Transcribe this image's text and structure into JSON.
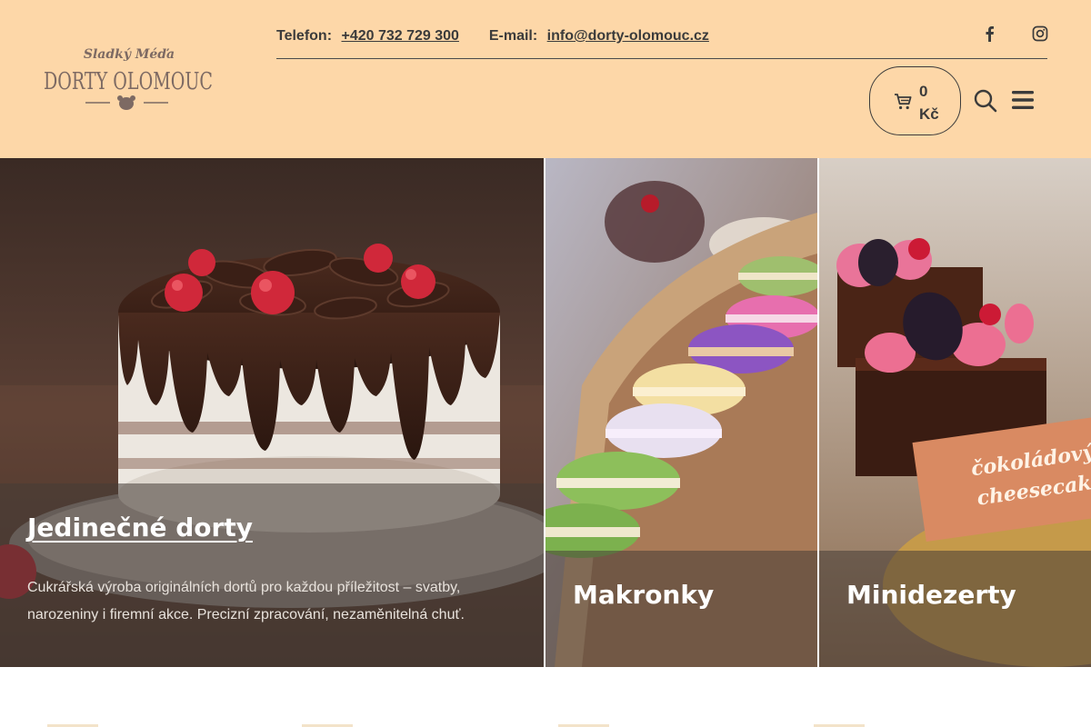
{
  "header": {
    "logo_top": "Sladký Méďa",
    "logo_main": "DORTY OLOMOUC",
    "phone_label": "Telefon:",
    "phone": "+420 732 729 300",
    "email_label": "E-mail:",
    "email": "info@dorty-olomouc.cz",
    "social": [
      "facebook-icon",
      "instagram-icon"
    ],
    "cart_amount_value": "0",
    "cart_amount_currency": "Kč"
  },
  "tiles": [
    {
      "title": "Jedinečné dorty",
      "description": "Cukrářská výroba originálních dortů pro každou příležitost – svatby, narozeniny i firemní akce. Precizní zpracování, nezaměnitelná chuť."
    },
    {
      "title": "Makronky"
    },
    {
      "title": "Minidezerty",
      "card_line1": "čokoládový",
      "card_line2": "cheesecake"
    }
  ],
  "colors": {
    "header_bg": "#fdd7a8",
    "text": "#3b3b3b",
    "overlay": "rgba(70,60,55,0.55)"
  }
}
